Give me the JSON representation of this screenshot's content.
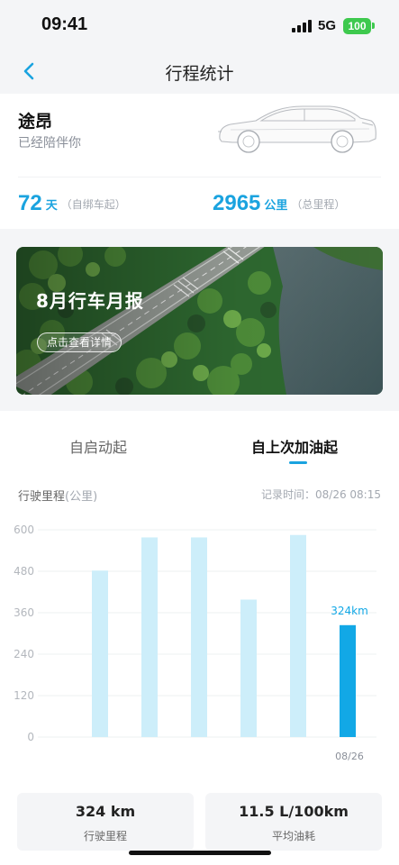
{
  "status_bar": {
    "time": "09:41",
    "network": "5G",
    "battery": "100"
  },
  "nav": {
    "title": "行程统计",
    "back_icon": "chevron-left-icon"
  },
  "car": {
    "name": "途昂",
    "subtitle": "已经陪伴你",
    "days": {
      "value": "72",
      "unit": "天",
      "note": "（自绑车起）"
    },
    "distance": {
      "value": "2965",
      "unit": "公里",
      "note": "（总里程）"
    }
  },
  "banner": {
    "title": "8月行车月报",
    "button": "点击查看详情"
  },
  "tabs": [
    {
      "label": "自启动起",
      "active": false
    },
    {
      "label": "自上次加油起",
      "active": true
    }
  ],
  "chart": {
    "label": "行驶里程",
    "unit_label": "(公里)",
    "record_time": "记录时间：08/26 08:15"
  },
  "chart_data": {
    "type": "bar",
    "title": "",
    "ylabel": "行驶里程(公里)",
    "ylim": [
      0,
      600
    ],
    "yticks": [
      "600",
      "480",
      "360",
      "240",
      "120",
      "0"
    ],
    "categories": [
      "",
      "",
      "",
      "",
      "",
      "",
      "08/26"
    ],
    "values": [
      0,
      482,
      578,
      578,
      398,
      585,
      324
    ],
    "highlight_index": 6,
    "highlight_label": "324km",
    "colors": {
      "bar": "#cdeefa",
      "highlight": "#12a8e6",
      "grid": "#eef0f2"
    }
  },
  "metrics": [
    {
      "value": "324 km",
      "label": "行驶里程"
    },
    {
      "value": "11.5 L/100km",
      "label": "平均油耗"
    }
  ],
  "colors": {
    "accent": "#1aa3df",
    "background": "#f4f5f7"
  }
}
